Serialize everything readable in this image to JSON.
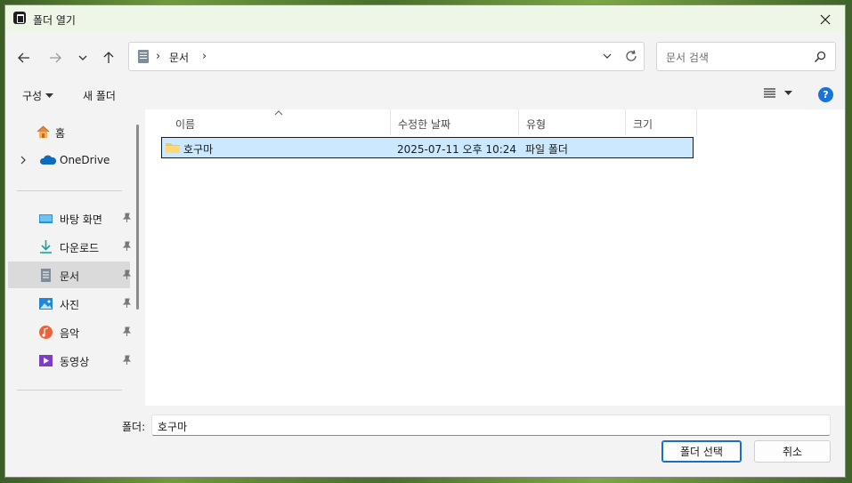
{
  "window": {
    "title": "폴더 열기"
  },
  "address": {
    "location": "문서",
    "separator": "›"
  },
  "search": {
    "placeholder": "문서 검색"
  },
  "toolbar": {
    "organize": "구성",
    "new_folder": "새 폴더",
    "help": "?"
  },
  "sidebar": {
    "home": "홈",
    "onedrive": "OneDrive",
    "pinned": [
      {
        "label": "바탕 화면",
        "icon": "desktop-icon"
      },
      {
        "label": "다운로드",
        "icon": "download-icon"
      },
      {
        "label": "문서",
        "icon": "documents-icon",
        "selected": true
      },
      {
        "label": "사진",
        "icon": "pictures-icon"
      },
      {
        "label": "음악",
        "icon": "music-icon"
      },
      {
        "label": "동영상",
        "icon": "videos-icon"
      }
    ]
  },
  "columns": {
    "name": "이름",
    "modified": "수정한 날짜",
    "type": "유형",
    "size": "크기"
  },
  "files": [
    {
      "name": "호구마",
      "modified": "2025-07-11 오후 10:24",
      "type": "파일 폴더",
      "size": ""
    }
  ],
  "bottom": {
    "folder_label": "폴더:",
    "folder_value": "호구마",
    "select_button": "폴더 선택",
    "cancel_button": "취소"
  },
  "colors": {
    "accent": "#1a6fc4",
    "selection": "#cce8ff",
    "titlebar": "#eef6e8"
  }
}
